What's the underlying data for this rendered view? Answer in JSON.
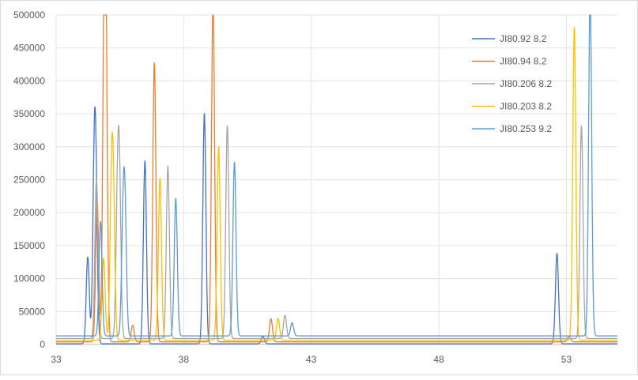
{
  "chart_data": {
    "type": "line",
    "title": "",
    "xlabel": "",
    "ylabel": "",
    "xlim": [
      33,
      55
    ],
    "ylim": [
      0,
      500000
    ],
    "x_ticks": [
      33,
      38,
      43,
      48,
      53
    ],
    "y_ticks": [
      0,
      50000,
      100000,
      150000,
      200000,
      250000,
      300000,
      350000,
      400000,
      450000,
      500000
    ],
    "grid": true,
    "legend_position": "top-right",
    "peak_width": 0.06,
    "series": [
      {
        "name": "JI80.92 8.2",
        "color": "#4472C4",
        "baseline": 1000,
        "peaks": [
          [
            34.24,
            132000
          ],
          [
            34.49,
            222000
          ],
          [
            34.56,
            205000
          ],
          [
            36.48,
            278000
          ],
          [
            38.81,
            350000
          ],
          [
            41.1,
            12000
          ],
          [
            52.63,
            138000
          ]
        ]
      },
      {
        "name": "JI80.94 8.2",
        "color": "#ED7D31",
        "baseline": 4000,
        "peaks": [
          [
            34.61,
            213000
          ],
          [
            34.89,
            476000
          ],
          [
            34.95,
            360000
          ],
          [
            36.0,
            25000
          ],
          [
            36.85,
            424000
          ],
          [
            39.15,
            520000
          ],
          [
            41.42,
            35000
          ],
          [
            53.1,
            8000
          ]
        ]
      },
      {
        "name": "JI80.206 8.2",
        "color": "#A5A5A5",
        "baseline": 9000,
        "peaks": [
          [
            34.58,
            243000
          ],
          [
            35.48,
            227000
          ],
          [
            35.4,
            175000
          ],
          [
            37.38,
            262000
          ],
          [
            39.71,
            323000
          ],
          [
            41.97,
            35000
          ],
          [
            53.59,
            323000
          ]
        ]
      },
      {
        "name": "JI80.203 8.2",
        "color": "#FFC000",
        "baseline": 6500,
        "peaks": [
          [
            34.86,
            125000
          ],
          [
            35.17,
            218000
          ],
          [
            35.25,
            175000
          ],
          [
            37.07,
            246000
          ],
          [
            39.37,
            294000
          ],
          [
            41.7,
            33000
          ],
          [
            53.31,
            475000
          ]
        ]
      },
      {
        "name": "JI80.253 9.2",
        "color": "#5B9BD5",
        "baseline": 13000,
        "peaks": [
          [
            34.74,
            174000
          ],
          [
            35.7,
            170000
          ],
          [
            35.62,
            150000
          ],
          [
            37.69,
            209000
          ],
          [
            39.99,
            264000
          ],
          [
            42.25,
            20000
          ],
          [
            53.93,
            520000
          ]
        ]
      }
    ]
  }
}
